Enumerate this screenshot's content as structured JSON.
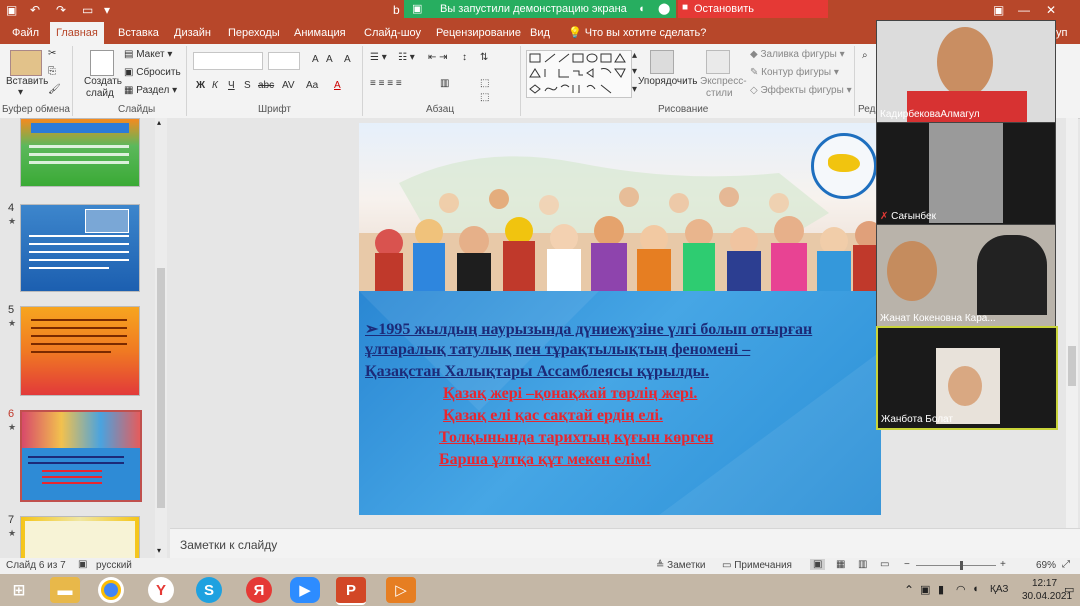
{
  "titlebar": {
    "share_banner": "Вы запустили демонстрацию экрана",
    "stop_share": "Остановить демонстрацию",
    "doc_prefix": "b"
  },
  "tabs": [
    "Файл",
    "Главная",
    "Вставка",
    "Дизайн",
    "Переходы",
    "Анимация",
    "Слайд-шоу",
    "Рецензирование",
    "Вид"
  ],
  "tell_me": "Что вы хотите сделать?",
  "ribbon": {
    "paste": "Вставить",
    "clipboard": "Буфер обмена",
    "new_slide_1": "Создать",
    "new_slide_2": "слайд",
    "layout": "Макет",
    "reset": "Сбросить",
    "section": "Раздел",
    "slides_group": "Слайды",
    "font_group": "Шрифт",
    "paragraph_group": "Абзац",
    "drawing_group": "Рисование",
    "arrange": "Упорядочить",
    "quick_styles_1": "Экспресс-",
    "quick_styles_2": "стили",
    "shape_fill": "Заливка фигуры",
    "shape_outline": "Контур фигуры",
    "shape_effects": "Эффекты фигуры",
    "bold": "Ж",
    "italic": "К",
    "underline": "Ч",
    "strike": "S",
    "abc": "abc",
    "av": "AV",
    "aa": "Aa",
    "fontcolor": "A",
    "editing_partial": "Ред",
    "group_partial": "уп"
  },
  "thumbnails": [
    {
      "num": "4",
      "star": "★"
    },
    {
      "num": "5",
      "star": "★"
    },
    {
      "num": "6",
      "star": "★"
    },
    {
      "num": "7",
      "star": "★"
    }
  ],
  "slide": {
    "lines": [
      "➢1995 жылдың наурызында дүниежүзіне үлгі болып отырған",
      "ұлтаралық татулық пен тұрақтылықтың феномені –",
      "Қазақстан Халықтары Ассамблеясы құрылды.",
      "Қазақ жері –қонақжай төрлің жері.",
      "Қазақ елі қас сақтай ердің елі.",
      "Толқынында тарихтың күғын көрген",
      "Барша ұлтқа құт мекен елім!"
    ]
  },
  "notes_placeholder": "Заметки к слайду",
  "status": {
    "slide_of": "Слайд 6 из 7",
    "language": "русский",
    "notes": "Заметки",
    "comments": "Примечания",
    "zoom": "69%"
  },
  "participants": [
    {
      "name": "КадирбековаАлмагул"
    },
    {
      "name": "Сағынбек"
    },
    {
      "name": "Жанат Кокеновна Кара..."
    },
    {
      "name": "Жанбота Болат"
    }
  ],
  "taskbar": {
    "lang": "ҚАЗ",
    "time": "12:17",
    "date": "30.04.2021"
  },
  "colors": {
    "accent": "#b7472a",
    "share_green": "#27ae60",
    "stop_red": "#e53935",
    "slide_red": "#e8262f",
    "slide_navy": "#1c2a78"
  }
}
